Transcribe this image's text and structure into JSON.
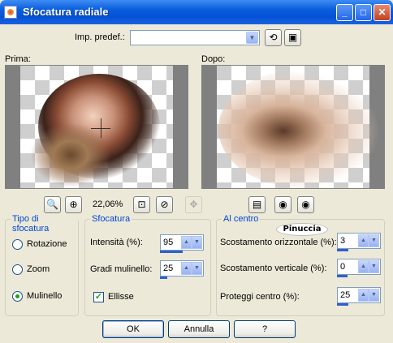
{
  "window": {
    "title": "Sfocatura radiale",
    "minimize": "_",
    "maximize": "□",
    "close": "✕"
  },
  "preset": {
    "label": "Imp. predef.:",
    "value": ""
  },
  "previews": {
    "before_label": "Prima:",
    "after_label": "Dopo:"
  },
  "zoom": {
    "value": "22,06%"
  },
  "blur_type": {
    "legend": "Tipo di sfocatura",
    "options": [
      "Rotazione",
      "Zoom",
      "Mulinello"
    ],
    "selected": "Mulinello"
  },
  "blur": {
    "legend": "Sfocatura",
    "intensity_label": "Intensità (%):",
    "intensity_value": "95",
    "twist_label": "Gradi mulinello:",
    "twist_value": "25",
    "ellipse_label": "Ellisse",
    "ellipse_checked": true
  },
  "center": {
    "legend": "Al centro",
    "h_offset_label": "Scostamento orizzontale (%):",
    "h_offset_value": "3",
    "v_offset_label": "Scostamento verticale (%):",
    "v_offset_value": "0",
    "protect_label": "Proteggi centro (%):",
    "protect_value": "25"
  },
  "watermark": "Pinuccia",
  "buttons": {
    "ok": "OK",
    "cancel": "Annulla",
    "help": "?"
  }
}
